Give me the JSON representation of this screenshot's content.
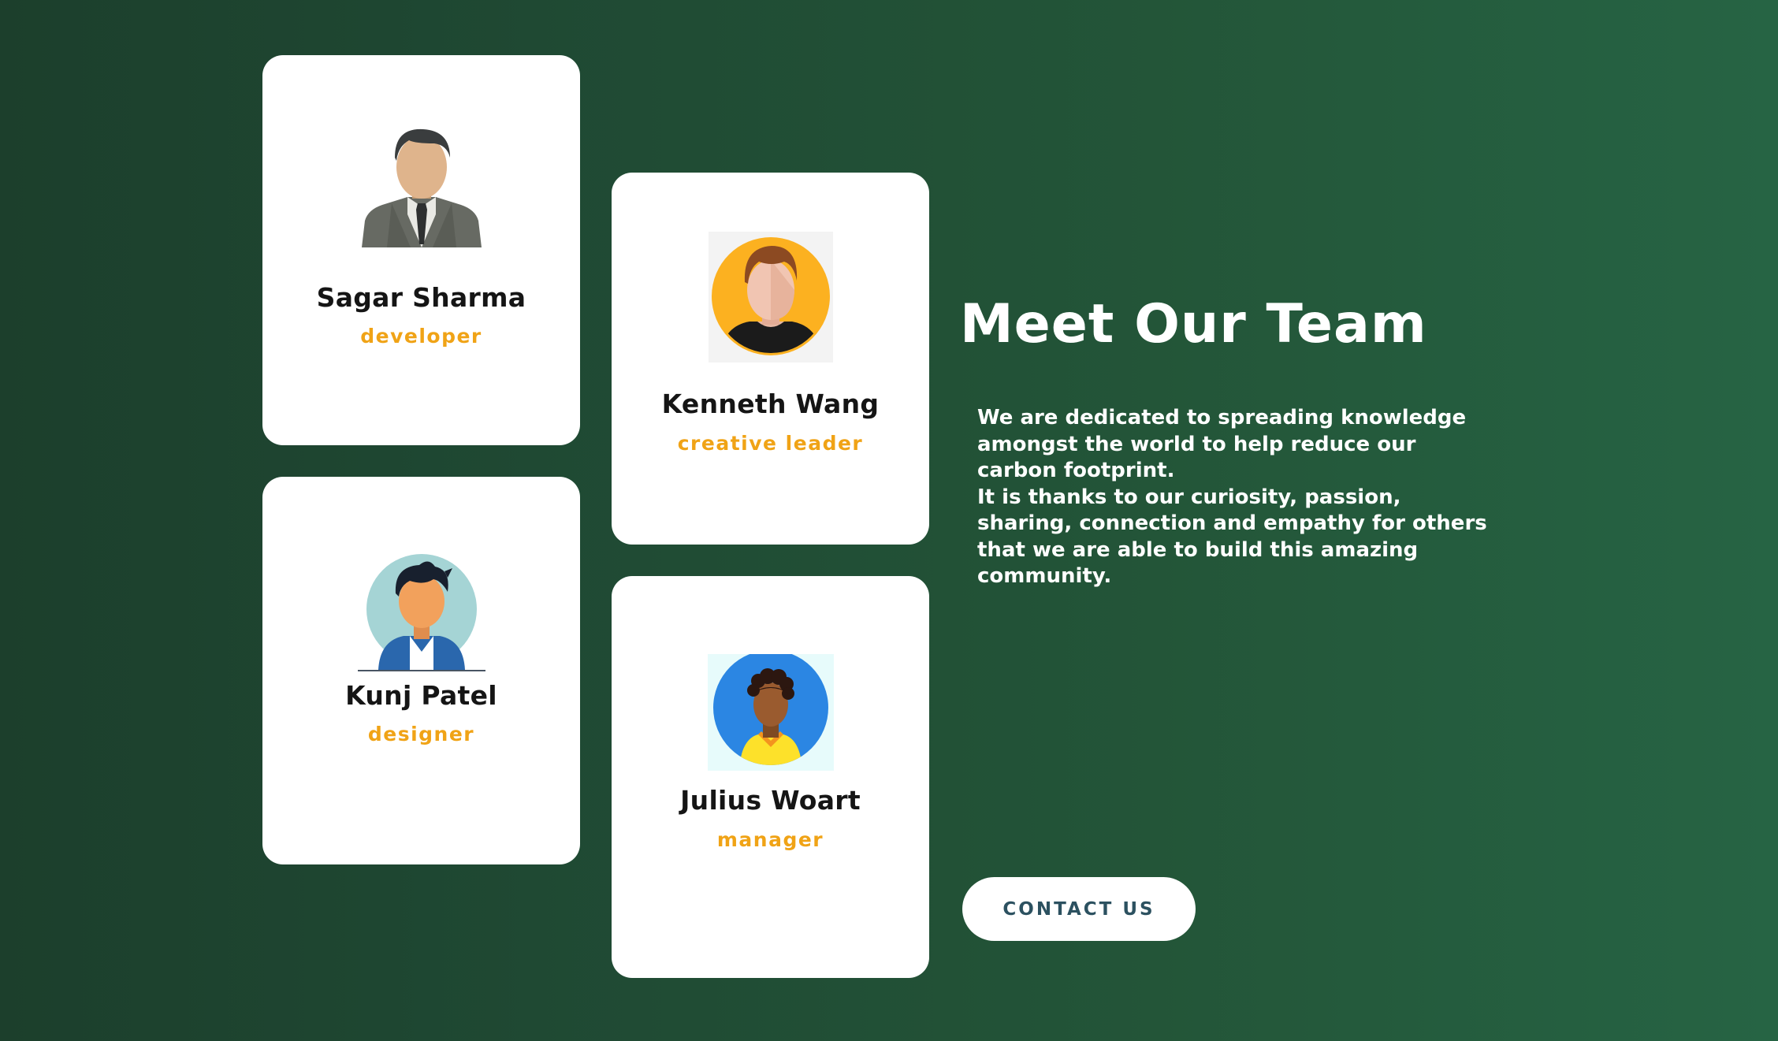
{
  "team": {
    "members": [
      {
        "name": "Sagar Sharma",
        "role": "developer",
        "avatar": "businessman-avatar-icon"
      },
      {
        "name": "Kenneth Wang",
        "role": "creative leader",
        "avatar": "man-avatar-orange-icon"
      },
      {
        "name": "Kunj Patel",
        "role": "designer",
        "avatar": "boy-avatar-icon"
      },
      {
        "name": "Julius Woart",
        "role": "manager",
        "avatar": "man-avatar-blue-icon"
      }
    ]
  },
  "intro": {
    "title": "Meet Our Team",
    "paragraph_1": "We are dedicated to spreading knowledge amongst the world to help reduce our carbon footprint.",
    "paragraph_2": "It is thanks to our curiosity, passion, sharing, connection and empathy for others that we are able to build this amazing community."
  },
  "contact_button": {
    "label": "CONTACT US"
  },
  "colors": {
    "background_start": "#1c3f2c",
    "background_end": "#266444",
    "card": "#ffffff",
    "name_text": "#151515",
    "role_text": "#f0a316",
    "button_text": "#2c5160"
  }
}
